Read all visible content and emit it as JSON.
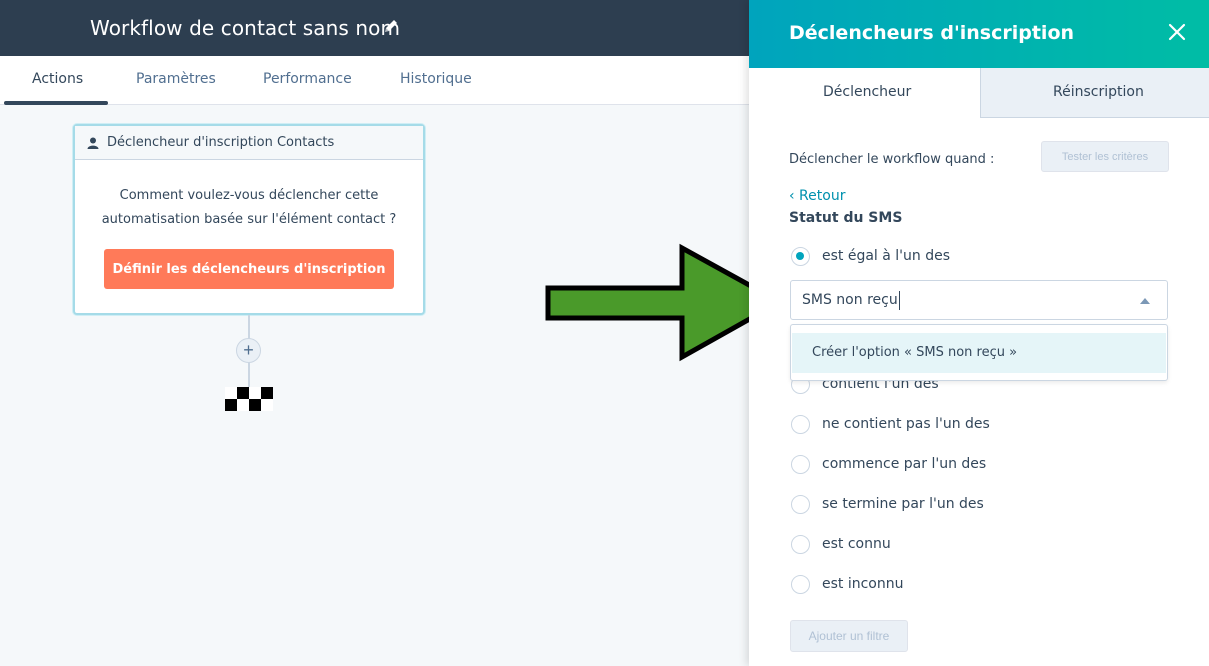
{
  "header": {
    "title": "Workflow de contact sans nom",
    "edit_icon": "pencil-icon"
  },
  "tabs": [
    {
      "label": "Actions",
      "active": true
    },
    {
      "label": "Paramètres",
      "active": false
    },
    {
      "label": "Performance",
      "active": false
    },
    {
      "label": "Historique",
      "active": false
    }
  ],
  "canvas": {
    "trigger_card": {
      "title": "Déclencheur d'inscription Contacts",
      "question_line1": "Comment voulez-vous déclencher cette",
      "question_line2": "automatisation basée sur l'élément contact ?",
      "button_label": "Définir les déclencheurs d'inscription"
    },
    "add_icon": "+"
  },
  "panel": {
    "title": "Déclencheurs d'inscription",
    "tabs": [
      {
        "label": "Déclencheur",
        "active": true
      },
      {
        "label": "Réinscription",
        "active": false
      }
    ],
    "trigger_when_label": "Déclencher le workflow quand :",
    "test_button": "Tester les critères",
    "back_link": "‹  Retour",
    "property_title": "Statut du SMS",
    "operators": [
      {
        "label": "est égal à l'un des",
        "checked": true
      },
      {
        "label": "contient l'un des",
        "checked": false
      },
      {
        "label": "ne contient pas l'un des",
        "checked": false
      },
      {
        "label": "commence par l'un des",
        "checked": false
      },
      {
        "label": "se termine par l'un des",
        "checked": false
      },
      {
        "label": "est connu",
        "checked": false
      },
      {
        "label": "est inconnu",
        "checked": false
      }
    ],
    "select_value": "SMS non reçu",
    "dropdown_option": "Créer l'option « SMS non reçu »",
    "add_filter_button": "Ajouter un filtre"
  },
  "colors": {
    "topbar": "#2d3e50",
    "accent_teal": "#00a4bd",
    "orange_button": "#ff7a59",
    "arrow_green": "#4a9a2a"
  }
}
